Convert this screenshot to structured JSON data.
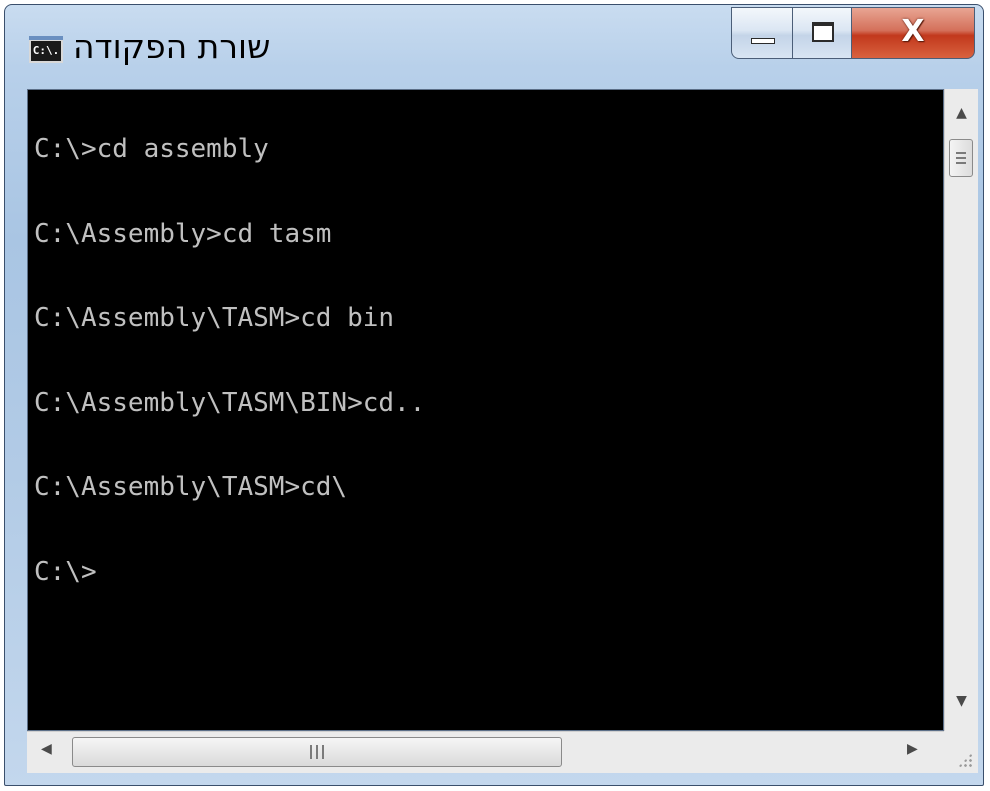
{
  "window": {
    "title": "שורת הפקודה",
    "icon": "cmd-icon",
    "icon_text": "C:\\."
  },
  "controls": {
    "minimize": "minimize-icon",
    "maximize": "maximize-icon",
    "close": "X"
  },
  "console": {
    "lines": [
      "C:\\>cd assembly",
      "C:\\Assembly>cd tasm",
      "C:\\Assembly\\TASM>cd bin",
      "C:\\Assembly\\TASM\\BIN>cd..",
      "C:\\Assembly\\TASM>cd\\",
      "C:\\>"
    ],
    "text_color": "#c0c0c0",
    "background": "#000000"
  },
  "scrollbars": {
    "vertical": {
      "up": "▲",
      "down": "▼"
    },
    "horizontal": {
      "left": "◀",
      "right": "▶"
    }
  }
}
